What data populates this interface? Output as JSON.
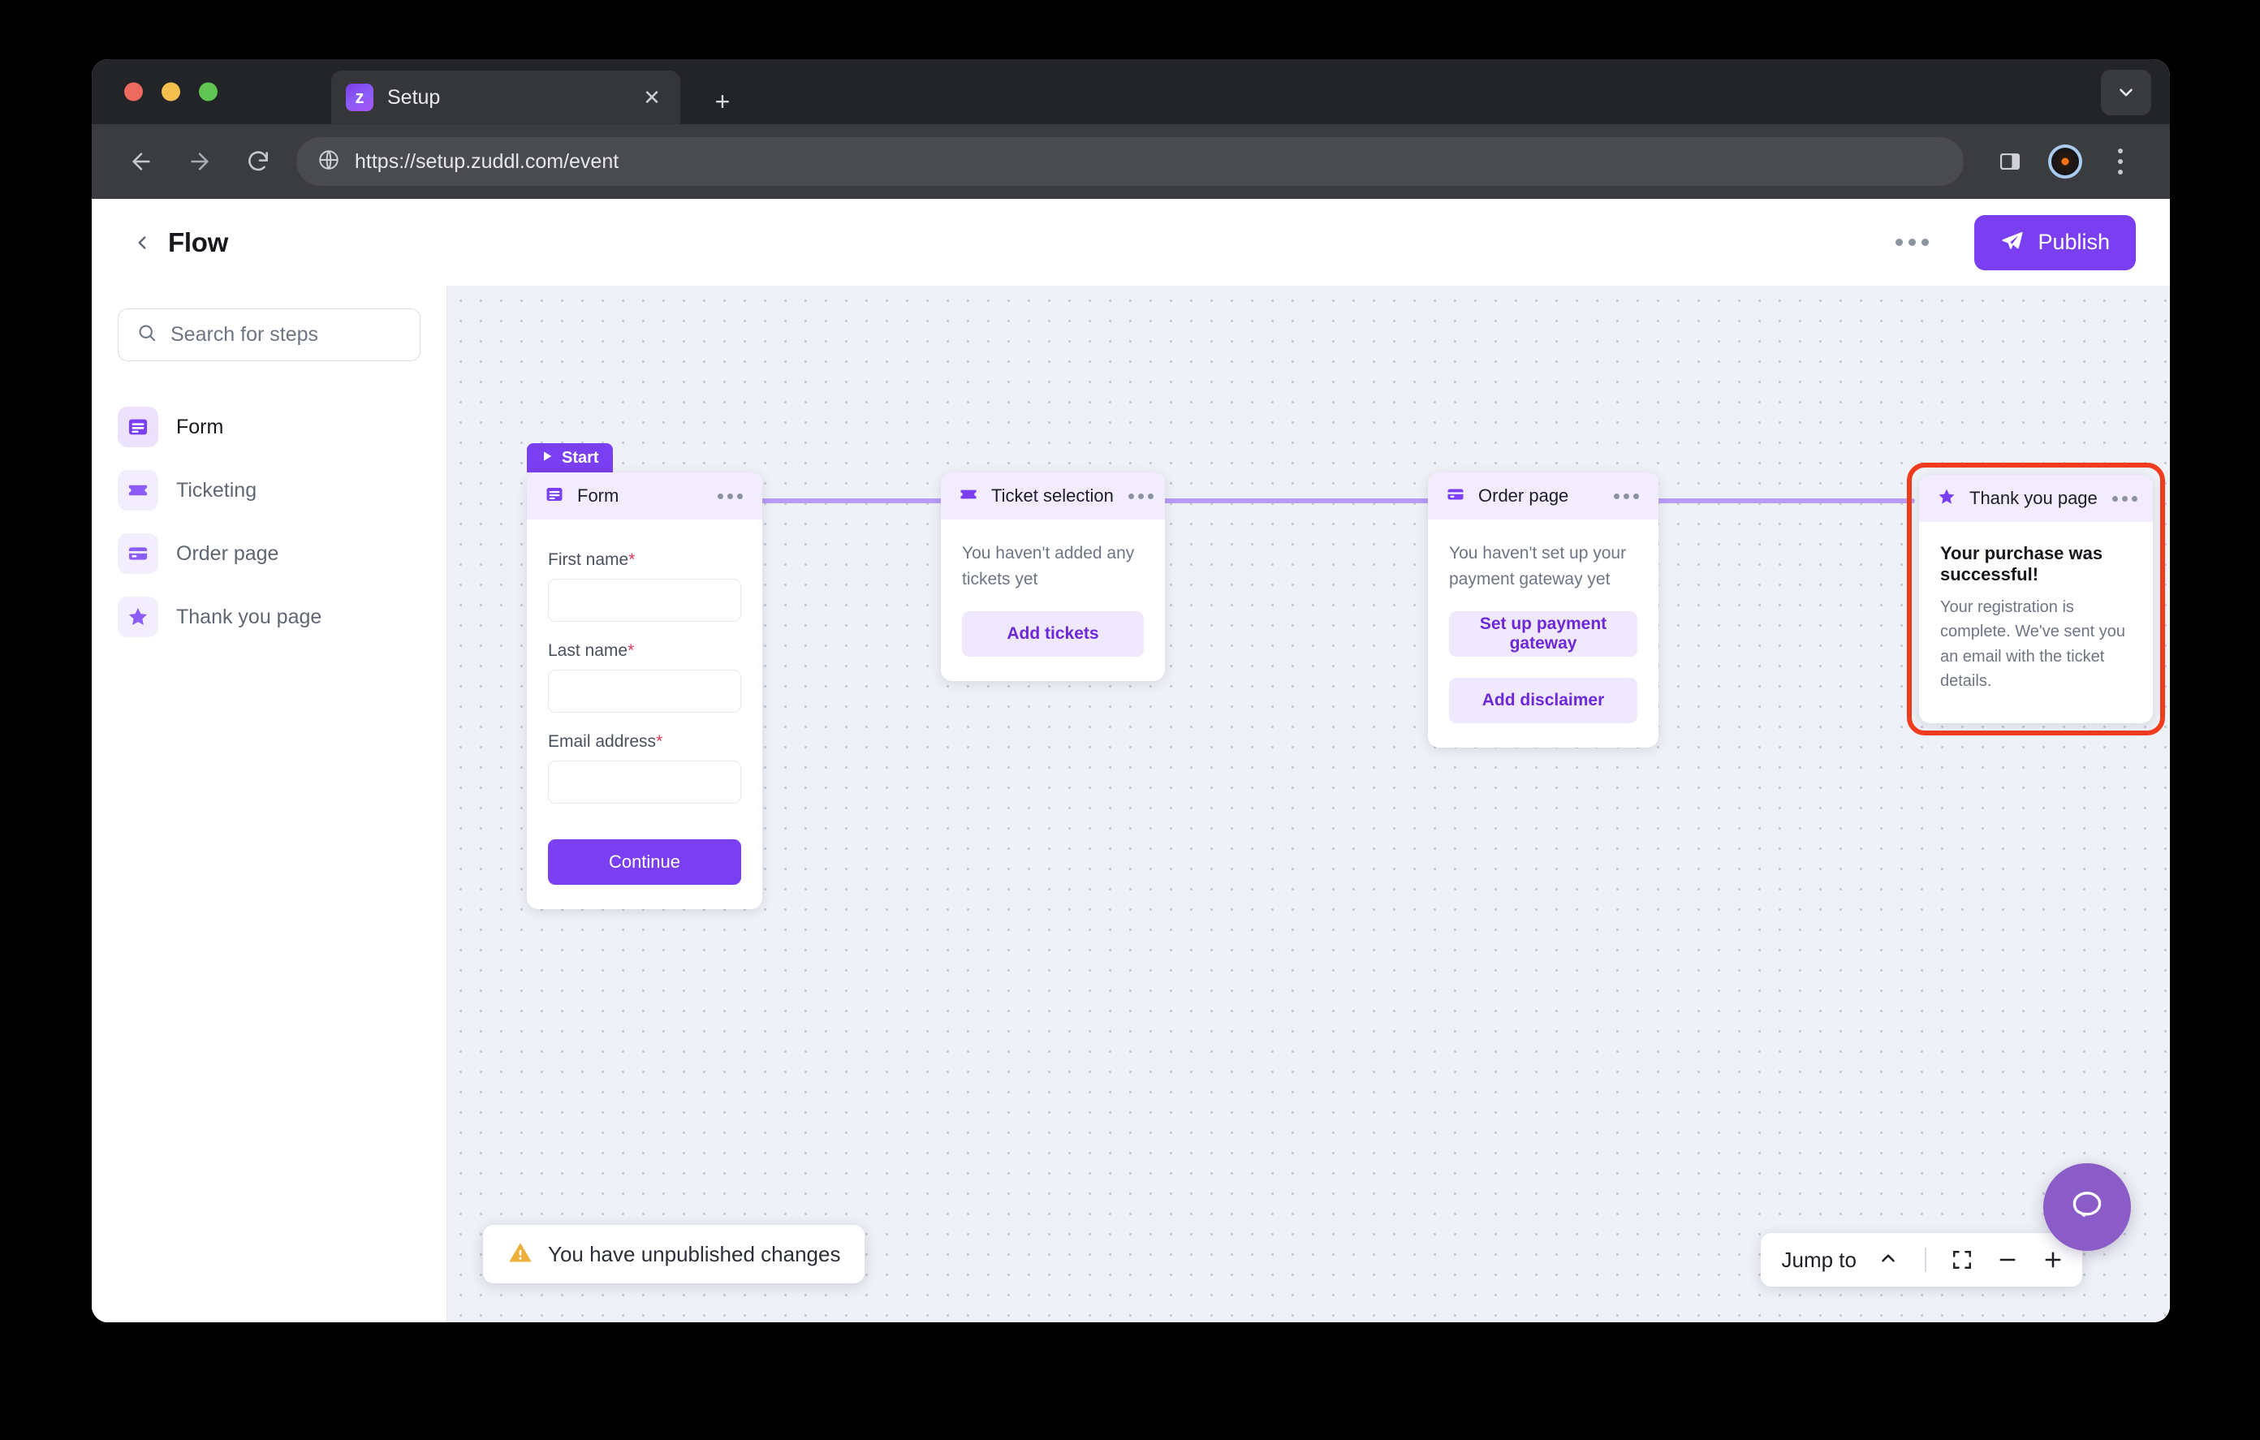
{
  "browser": {
    "tab": {
      "title": "Setup",
      "favicon_letter": "z",
      "close_icon": "close-icon"
    },
    "new_tab_icon": "plus-icon",
    "tab_list_icon": "chevron-down-icon",
    "url": "https://setup.zuddl.com/event",
    "icons": {
      "back": "back-arrow-icon",
      "forward": "forward-arrow-icon",
      "reload": "reload-icon",
      "globe": "globe-icon",
      "side_panel": "side-panel-icon",
      "profile": "profile-avatar",
      "menu": "kebab-menu-icon"
    }
  },
  "header": {
    "back_icon": "chevron-left-icon",
    "title": "Flow",
    "more_icon": "more-horizontal-icon",
    "publish_label": "Publish",
    "publish_icon": "send-icon"
  },
  "sidebar": {
    "search": {
      "placeholder": "Search for steps",
      "value": "",
      "icon": "search-icon"
    },
    "items": [
      {
        "label": "Form",
        "icon": "form-icon",
        "active": true
      },
      {
        "label": "Ticketing",
        "icon": "ticket-icon",
        "active": false
      },
      {
        "label": "Order page",
        "icon": "card-icon",
        "active": false
      },
      {
        "label": "Thank you page",
        "icon": "star-icon",
        "active": false
      }
    ]
  },
  "canvas": {
    "start_badge": {
      "label": "Start",
      "icon": "play-icon"
    },
    "nodes": {
      "form": {
        "title": "Form",
        "icon": "form-icon",
        "more_icon": "more-horizontal-icon",
        "fields": [
          {
            "label": "First name",
            "required_marker": "*",
            "value": ""
          },
          {
            "label": "Last name",
            "required_marker": "*",
            "value": ""
          },
          {
            "label": "Email address",
            "required_marker": "*",
            "value": ""
          }
        ],
        "submit_label": "Continue"
      },
      "ticket": {
        "title": "Ticket selection",
        "icon": "ticket-icon",
        "more_icon": "more-horizontal-icon",
        "empty_text": "You haven't added any tickets yet",
        "action_label": "Add tickets"
      },
      "order": {
        "title": "Order page",
        "icon": "card-icon",
        "more_icon": "more-horizontal-icon",
        "empty_text": "You haven't set up your payment gateway yet",
        "action_label": "Set up payment gateway",
        "secondary_action_label": "Add disclaimer"
      },
      "thankyou": {
        "title": "Thank you page",
        "icon": "star-icon",
        "more_icon": "more-horizontal-icon",
        "heading": "Your purchase was successful!",
        "subtext": "Your registration is complete. We've sent you an email with the ticket details.",
        "selected": true
      }
    }
  },
  "bottom": {
    "toast": {
      "text": "You have unpublished changes",
      "icon": "warning-triangle-icon"
    },
    "zoom_controls": {
      "jump_to_label": "Jump to",
      "jump_to_icon": "chevron-up-icon",
      "fit_icon": "fit-screen-icon",
      "zoom_out_icon": "minus-icon",
      "zoom_in_icon": "plus-icon"
    },
    "help_icon": "chat-bubble-icon"
  },
  "colors": {
    "brand_purple": "#7b3ff2",
    "node_header": "#f3ecfe",
    "connector": "#b79df5",
    "selection_red": "#f03b1e",
    "warning_amber": "#eeb03c",
    "canvas_bg": "#eef1f6"
  }
}
